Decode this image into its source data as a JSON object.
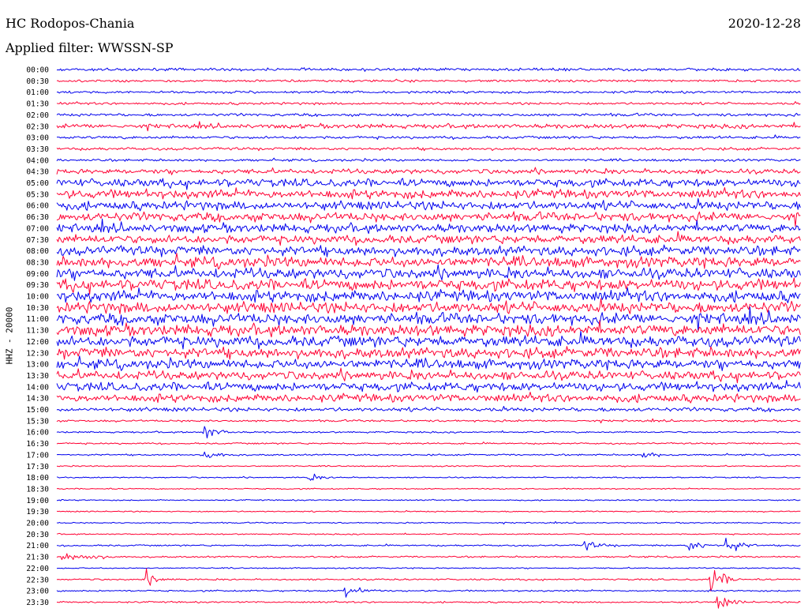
{
  "header": {
    "station": "HC Rodopos-Chania",
    "date": "2020-12-28",
    "filter": "Applied filter: WWSSN-SP"
  },
  "channel_label": "HHZ - 20000",
  "colors": {
    "trace_a": "#0000ee",
    "trace_b": "#ff0033",
    "background": "#ffffff"
  },
  "chart_data": {
    "type": "line",
    "title": "HC Rodopos-Chania",
    "x_axis_span_minutes": 30,
    "grid": false,
    "series": [
      {
        "label": "00:00",
        "amplitude": 0.35,
        "events": []
      },
      {
        "label": "00:30",
        "amplitude": 0.3,
        "events": []
      },
      {
        "label": "01:00",
        "amplitude": 0.3,
        "events": []
      },
      {
        "label": "01:30",
        "amplitude": 0.3,
        "events": []
      },
      {
        "label": "02:00",
        "amplitude": 0.35,
        "events": []
      },
      {
        "label": "02:30",
        "amplitude": 0.55,
        "events": []
      },
      {
        "label": "03:00",
        "amplitude": 0.35,
        "events": []
      },
      {
        "label": "03:30",
        "amplitude": 0.35,
        "events": []
      },
      {
        "label": "04:00",
        "amplitude": 0.3,
        "events": []
      },
      {
        "label": "04:30",
        "amplitude": 0.6,
        "events": []
      },
      {
        "label": "05:00",
        "amplitude": 1.0,
        "events": []
      },
      {
        "label": "05:30",
        "amplitude": 1.1,
        "events": []
      },
      {
        "label": "06:00",
        "amplitude": 1.1,
        "events": []
      },
      {
        "label": "06:30",
        "amplitude": 1.1,
        "events": []
      },
      {
        "label": "07:00",
        "amplitude": 1.1,
        "events": []
      },
      {
        "label": "07:30",
        "amplitude": 1.1,
        "events": []
      },
      {
        "label": "08:00",
        "amplitude": 1.2,
        "events": []
      },
      {
        "label": "08:30",
        "amplitude": 1.3,
        "events": []
      },
      {
        "label": "09:00",
        "amplitude": 1.3,
        "events": []
      },
      {
        "label": "09:30",
        "amplitude": 1.4,
        "events": []
      },
      {
        "label": "10:00",
        "amplitude": 1.4,
        "events": []
      },
      {
        "label": "10:30",
        "amplitude": 1.4,
        "events": []
      },
      {
        "label": "11:00",
        "amplitude": 1.4,
        "events": []
      },
      {
        "label": "11:30",
        "amplitude": 1.4,
        "events": []
      },
      {
        "label": "12:00",
        "amplitude": 1.4,
        "events": []
      },
      {
        "label": "12:30",
        "amplitude": 1.3,
        "events": []
      },
      {
        "label": "13:00",
        "amplitude": 1.2,
        "events": []
      },
      {
        "label": "13:30",
        "amplitude": 1.1,
        "events": []
      },
      {
        "label": "14:00",
        "amplitude": 1.1,
        "events": []
      },
      {
        "label": "14:30",
        "amplitude": 1.0,
        "events": []
      },
      {
        "label": "15:00",
        "amplitude": 0.5,
        "events": []
      },
      {
        "label": "15:30",
        "amplitude": 0.25,
        "events": []
      },
      {
        "label": "16:00",
        "amplitude": 0.2,
        "events": [
          {
            "t": 0.2,
            "amp": 1.2
          }
        ]
      },
      {
        "label": "16:30",
        "amplitude": 0.2,
        "events": []
      },
      {
        "label": "17:00",
        "amplitude": 0.2,
        "events": [
          {
            "t": 0.2,
            "amp": 0.8
          },
          {
            "t": 0.79,
            "amp": 0.5
          }
        ]
      },
      {
        "label": "17:30",
        "amplitude": 0.15,
        "events": []
      },
      {
        "label": "18:00",
        "amplitude": 0.15,
        "events": [
          {
            "t": 0.34,
            "amp": 0.5
          }
        ]
      },
      {
        "label": "18:30",
        "amplitude": 0.15,
        "events": []
      },
      {
        "label": "19:00",
        "amplitude": 0.15,
        "events": []
      },
      {
        "label": "19:30",
        "amplitude": 0.15,
        "events": []
      },
      {
        "label": "20:00",
        "amplitude": 0.15,
        "events": []
      },
      {
        "label": "20:30",
        "amplitude": 0.15,
        "events": []
      },
      {
        "label": "21:00",
        "amplitude": 0.2,
        "events": [
          {
            "t": 0.71,
            "amp": 0.8
          },
          {
            "t": 0.85,
            "amp": 1.0
          },
          {
            "t": 0.9,
            "amp": 1.5
          }
        ]
      },
      {
        "label": "21:30",
        "amplitude": 0.2,
        "events": [
          {
            "t": 0.01,
            "amp": 0.8
          },
          {
            "t": 0.04,
            "amp": 0.7
          }
        ]
      },
      {
        "label": "22:00",
        "amplitude": 0.15,
        "events": []
      },
      {
        "label": "22:30",
        "amplitude": 0.2,
        "events": [
          {
            "t": 0.12,
            "amp": 0.9
          },
          {
            "t": 0.88,
            "amp": 2.2
          }
        ]
      },
      {
        "label": "23:00",
        "amplitude": 0.2,
        "events": [
          {
            "t": 0.39,
            "amp": 1.3
          }
        ]
      },
      {
        "label": "23:30",
        "amplitude": 0.2,
        "events": [
          {
            "t": 0.89,
            "amp": 1.0
          }
        ]
      }
    ]
  }
}
